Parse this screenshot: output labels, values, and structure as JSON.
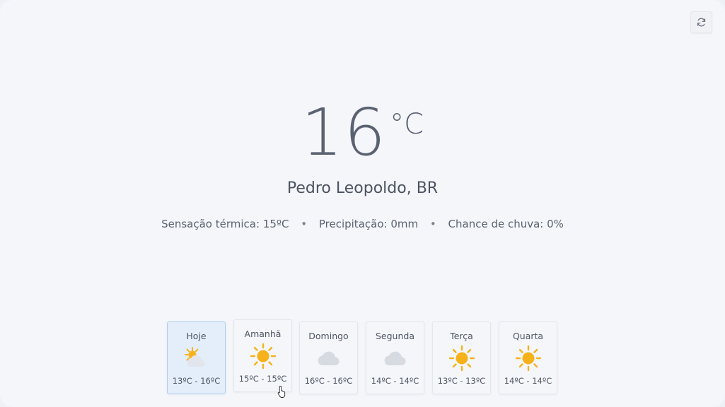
{
  "current": {
    "temperature": "16",
    "unit": "°C",
    "city": "Pedro Leopoldo, BR",
    "feels_like": "Sensação térmica: 15ºC",
    "precipitation": "Precipitação: 0mm",
    "rain_chance": "Chance de chuva: 0%",
    "separator": "•"
  },
  "toolbar": {
    "refresh_icon": "refresh-icon"
  },
  "forecast": [
    {
      "day": "Hoje",
      "icon": "partly-cloudy-icon",
      "range": "13ºC - 16ºC",
      "active": true
    },
    {
      "day": "Amanhã",
      "icon": "sun-icon",
      "range": "15ºC - 15ºC",
      "active": false
    },
    {
      "day": "Domingo",
      "icon": "cloud-icon",
      "range": "16ºC - 16ºC",
      "active": false
    },
    {
      "day": "Segunda",
      "icon": "cloud-icon",
      "range": "14ºC - 14ºC",
      "active": false
    },
    {
      "day": "Terça",
      "icon": "sun-icon",
      "range": "13ºC - 13ºC",
      "active": false
    },
    {
      "day": "Quarta",
      "icon": "sun-icon",
      "range": "14ºC - 14ºC",
      "active": false
    }
  ],
  "colors": {
    "active_bg": "#e4eefb",
    "active_border": "#a9cdf0",
    "sun": "#f7b21b",
    "cloud": "#d6dbe2"
  }
}
